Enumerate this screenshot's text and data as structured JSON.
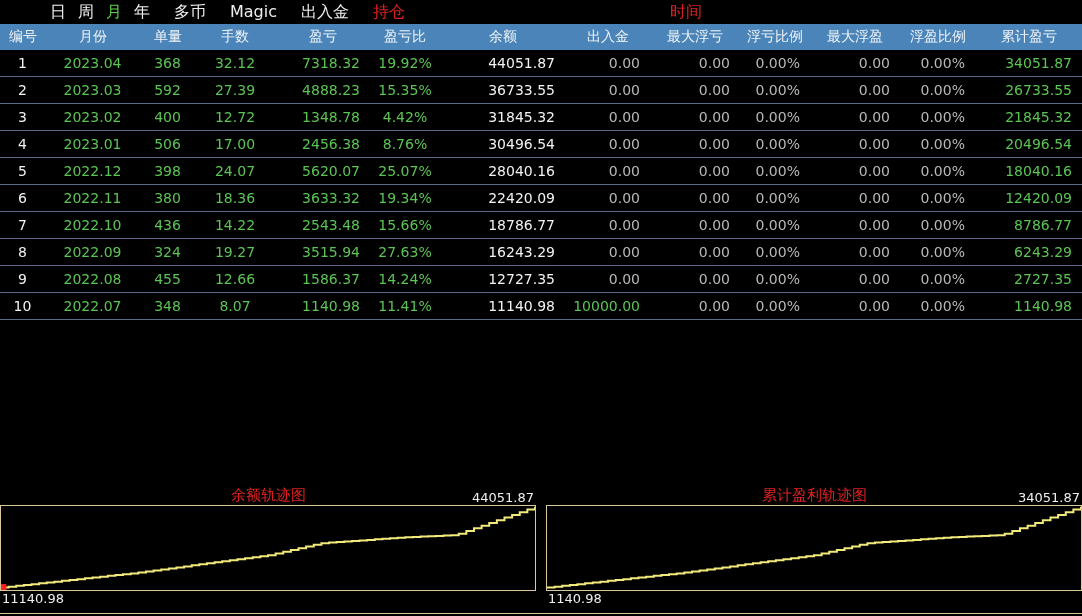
{
  "period_tabs": [
    {
      "label": "日",
      "selected": false
    },
    {
      "label": "周",
      "selected": false
    },
    {
      "label": "月",
      "selected": true
    },
    {
      "label": "年",
      "selected": false
    }
  ],
  "menu": [
    {
      "label": "多币",
      "active": false
    },
    {
      "label": "Magic",
      "active": false
    },
    {
      "label": "出入金",
      "active": false
    },
    {
      "label": "持仓",
      "active": true
    }
  ],
  "menu_right": [
    {
      "label": "时间",
      "active": true
    }
  ],
  "table": {
    "columns": [
      {
        "label": "编号",
        "kind": "index"
      },
      {
        "label": "月份",
        "kind": "trade"
      },
      {
        "label": "单量",
        "kind": "trade"
      },
      {
        "label": "手数",
        "kind": "trade"
      },
      {
        "label": "盈亏",
        "kind": "profit"
      },
      {
        "label": "盈亏比",
        "kind": "trade"
      },
      {
        "label": "余额",
        "kind": "balance"
      },
      {
        "label": "出入金",
        "kind": "float"
      },
      {
        "label": "最大浮亏",
        "kind": "float"
      },
      {
        "label": "浮亏比例",
        "kind": "float"
      },
      {
        "label": "最大浮盈",
        "kind": "float"
      },
      {
        "label": "浮盈比例",
        "kind": "float"
      },
      {
        "label": "累计盈亏",
        "kind": "profit"
      }
    ],
    "rows": [
      {
        "cells": [
          "1",
          "2023.04",
          "368",
          "32.12",
          "7318.32",
          "19.92%",
          "44051.87",
          "0.00",
          "0.00",
          "0.00%",
          "0.00",
          "0.00%",
          "34051.87"
        ],
        "deposit": false
      },
      {
        "cells": [
          "2",
          "2023.03",
          "592",
          "27.39",
          "4888.23",
          "15.35%",
          "36733.55",
          "0.00",
          "0.00",
          "0.00%",
          "0.00",
          "0.00%",
          "26733.55"
        ],
        "deposit": false
      },
      {
        "cells": [
          "3",
          "2023.02",
          "400",
          "12.72",
          "1348.78",
          "4.42%",
          "31845.32",
          "0.00",
          "0.00",
          "0.00%",
          "0.00",
          "0.00%",
          "21845.32"
        ],
        "deposit": false
      },
      {
        "cells": [
          "4",
          "2023.01",
          "506",
          "17.00",
          "2456.38",
          "8.76%",
          "30496.54",
          "0.00",
          "0.00",
          "0.00%",
          "0.00",
          "0.00%",
          "20496.54"
        ],
        "deposit": false
      },
      {
        "cells": [
          "5",
          "2022.12",
          "398",
          "24.07",
          "5620.07",
          "25.07%",
          "28040.16",
          "0.00",
          "0.00",
          "0.00%",
          "0.00",
          "0.00%",
          "18040.16"
        ],
        "deposit": false
      },
      {
        "cells": [
          "6",
          "2022.11",
          "380",
          "18.36",
          "3633.32",
          "19.34%",
          "22420.09",
          "0.00",
          "0.00",
          "0.00%",
          "0.00",
          "0.00%",
          "12420.09"
        ],
        "deposit": false
      },
      {
        "cells": [
          "7",
          "2022.10",
          "436",
          "14.22",
          "2543.48",
          "15.66%",
          "18786.77",
          "0.00",
          "0.00",
          "0.00%",
          "0.00",
          "0.00%",
          "8786.77"
        ],
        "deposit": false
      },
      {
        "cells": [
          "8",
          "2022.09",
          "324",
          "19.27",
          "3515.94",
          "27.63%",
          "16243.29",
          "0.00",
          "0.00",
          "0.00%",
          "0.00",
          "0.00%",
          "6243.29"
        ],
        "deposit": false
      },
      {
        "cells": [
          "9",
          "2022.08",
          "455",
          "12.66",
          "1586.37",
          "14.24%",
          "12727.35",
          "0.00",
          "0.00",
          "0.00%",
          "0.00",
          "0.00%",
          "2727.35"
        ],
        "deposit": false
      },
      {
        "cells": [
          "10",
          "2022.07",
          "348",
          "8.07",
          "1140.98",
          "11.41%",
          "11140.98",
          "10000.00",
          "0.00",
          "0.00%",
          "0.00",
          "0.00%",
          "1140.98"
        ],
        "deposit": true
      }
    ]
  },
  "charts": [
    {
      "title": "余额轨迹图",
      "max_label": "44051.87",
      "min_label": "11140.98",
      "start_marker": true
    },
    {
      "title": "累计盈利轨迹图",
      "max_label": "34051.87",
      "min_label": "1140.98",
      "start_marker": false
    }
  ]
}
